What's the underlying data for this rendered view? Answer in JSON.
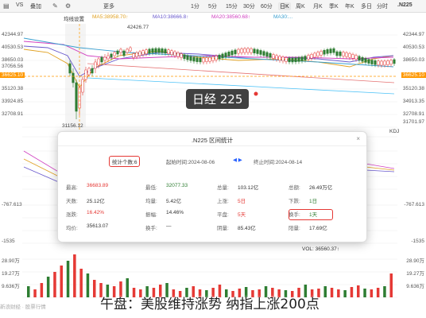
{
  "toolbar": {
    "left_items": [
      "VS",
      "叠加"
    ],
    "right_items": [
      "1分",
      "5分",
      "15分",
      "30分",
      "60分",
      "日K",
      "周K",
      "月K",
      "季K",
      "年K",
      "多日",
      "分时"
    ],
    "active": "日K",
    "index_name": ".N225",
    "more": "更多"
  },
  "ma_legend": [
    {
      "text": "均线设置",
      "color": "#555555"
    },
    {
      "text": "MA5:38958.70↑",
      "color": "#e0a020"
    },
    {
      "text": "MA10:38666.8↑",
      "color": "#6a5acd"
    },
    {
      "text": "MA20:38560.68↑",
      "color": "#d040c0"
    },
    {
      "text": "MA30:...",
      "color": "#3aa0d0"
    }
  ],
  "left_axis": [
    "42344.97",
    "40530.53",
    "38650.03",
    "37056.56",
    "36625.10",
    "35120.38",
    "33924.85",
    "32708.91",
    "31701.97",
    "30213.03",
    "28950.09"
  ],
  "right_axis": [
    "42344.97",
    "40530.53",
    "38650.03",
    "37056.56",
    "36625.10",
    "35120.38",
    "34913.35",
    "32708.91",
    "31701.97",
    "30213.03",
    "28950.09"
  ],
  "current_price": "36625.10",
  "annotations": {
    "high": "42426.77",
    "low": "31156.12"
  },
  "watermark": "日经 225",
  "kdj_label": "KDJ",
  "indicator_axis_left": [
    "5196",
    "1517",
    "0",
    "-767.613",
    "-1517",
    "-1535"
  ],
  "indicator_axis_right": [
    "5196",
    "1517",
    "0",
    "-767.613",
    "-1517",
    "-1535"
  ],
  "dialog": {
    "title": ".N225 区间统计",
    "close": "×",
    "start_label": "起始时间:",
    "start_date": "2024-08-06",
    "end_label": "终止时间:",
    "end_date": "2024-08-14",
    "count_label": "统计个数:",
    "count_value": "6",
    "rows": [
      [
        {
          "l": "最高:",
          "v": "36683.89",
          "c": "red"
        },
        {
          "l": "最低:",
          "v": "32077.33",
          "c": "green"
        },
        {
          "l": "总量:",
          "v": "103.12亿",
          "c": ""
        },
        {
          "l": "总额:",
          "v": "26.49万亿",
          "c": ""
        }
      ],
      [
        {
          "l": "天数:",
          "v": "25.12亿",
          "c": ""
        },
        {
          "l": "均量:",
          "v": "5.42亿",
          "c": ""
        },
        {
          "l": "上涨:",
          "v": "5日",
          "c": "red"
        },
        {
          "l": "下跌:",
          "v": "1日",
          "c": "green"
        }
      ],
      [
        {
          "l": "涨跌:",
          "v": "16.42%",
          "c": "red"
        },
        {
          "l": "振幅:",
          "v": "14.46%",
          "c": ""
        },
        {
          "l": "平盘:",
          "v": "5天",
          "c": "red"
        },
        {
          "l": "换手:",
          "v": "1天",
          "c": "green"
        }
      ],
      [
        {
          "l": "均价:",
          "v": "35613.07",
          "c": ""
        },
        {
          "l": "换手:",
          "v": "—",
          "c": ""
        },
        {
          "l": "阴量:",
          "v": "85.43亿",
          "c": ""
        },
        {
          "l": "阳量:",
          "v": "17.69亿",
          "c": ""
        }
      ]
    ]
  },
  "volume_legend": "VOL: 36560.37↑",
  "volume_axis_left": [
    "28.90万",
    "19.27万",
    "9.636万"
  ],
  "volume_axis_right": [
    "28.90万",
    "19.27万",
    "9.636万"
  ],
  "caption": "午盘：美股维持涨势 纳指上涨200点",
  "corner_mark": "新浪财经 · 股票行情"
}
